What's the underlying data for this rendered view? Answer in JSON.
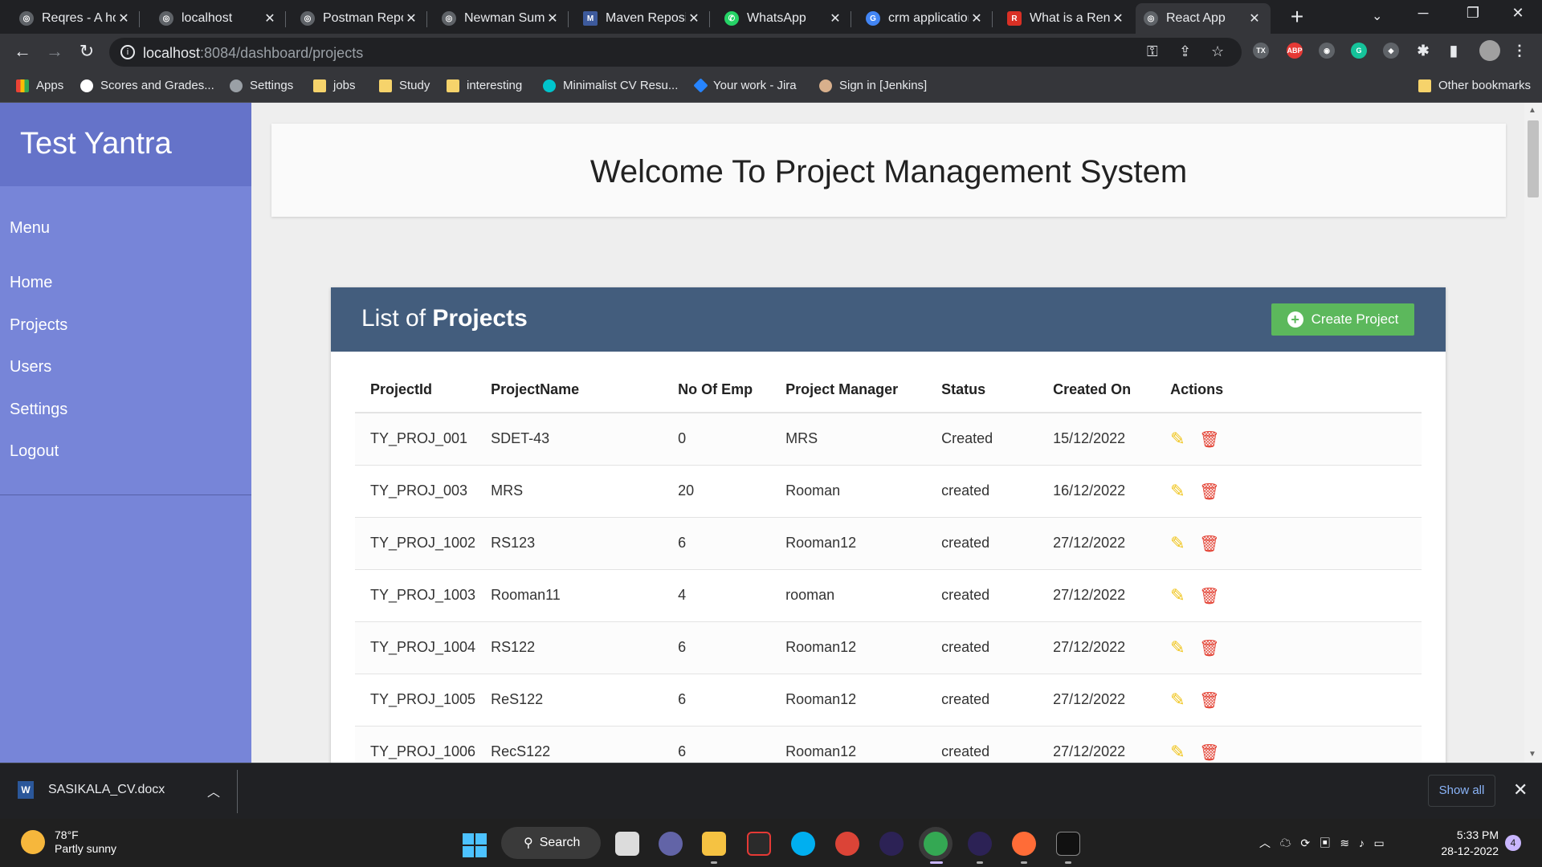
{
  "browser": {
    "tabs": [
      {
        "title": "Reqres - A hosted REST-API",
        "active": false
      },
      {
        "title": "localhost",
        "active": false
      },
      {
        "title": "Postman Report",
        "active": false
      },
      {
        "title": "Newman Summary Report",
        "active": false
      },
      {
        "title": "Maven Repository",
        "active": false
      },
      {
        "title": "WhatsApp",
        "active": false
      },
      {
        "title": "crm application",
        "active": false
      },
      {
        "title": "What is a Rental",
        "active": false
      },
      {
        "title": "React App",
        "active": true
      }
    ],
    "url_host": "localhost",
    "url_rest": ":8084/dashboard/projects",
    "bookmarks": [
      {
        "label": "Apps",
        "icon": "apps-grid-icon"
      },
      {
        "label": "Scores and Grades...",
        "icon": "google-icon"
      },
      {
        "label": "Settings",
        "icon": "gear-icon"
      },
      {
        "label": "jobs",
        "icon": "folder-icon"
      },
      {
        "label": "Study",
        "icon": "folder-icon"
      },
      {
        "label": "interesting",
        "icon": "folder-icon"
      },
      {
        "label": "Minimalist CV Resu...",
        "icon": "canva-icon"
      },
      {
        "label": "Your work - Jira",
        "icon": "jira-icon"
      },
      {
        "label": "Sign in [Jenkins]",
        "icon": "jenkins-icon"
      }
    ],
    "other_bookmarks": "Other bookmarks"
  },
  "app": {
    "brand": "Test Yantra",
    "menu_heading": "Menu",
    "nav": [
      "Home",
      "Projects",
      "Users",
      "Settings",
      "Logout"
    ],
    "welcome": "Welcome To Project Management System",
    "list_title_prefix": "List of",
    "list_title_bold": "Projects",
    "create_button": "Create Project",
    "columns": [
      "ProjectId",
      "ProjectName",
      "No Of Emp",
      "Project Manager",
      "Status",
      "Created On",
      "Actions"
    ],
    "rows": [
      [
        "TY_PROJ_001",
        "SDET-43",
        "0",
        "MRS",
        "Created",
        "15/12/2022"
      ],
      [
        "TY_PROJ_003",
        "MRS",
        "20",
        "Rooman",
        "created",
        "16/12/2022"
      ],
      [
        "TY_PROJ_1002",
        "RS123",
        "6",
        "Rooman12",
        "created",
        "27/12/2022"
      ],
      [
        "TY_PROJ_1003",
        "Rooman11",
        "4",
        "rooman",
        "created",
        "27/12/2022"
      ],
      [
        "TY_PROJ_1004",
        "RS122",
        "6",
        "Rooman12",
        "created",
        "27/12/2022"
      ],
      [
        "TY_PROJ_1005",
        "ReS122",
        "6",
        "Rooman12",
        "created",
        "27/12/2022"
      ],
      [
        "TY_PROJ_1006",
        "RecS122",
        "6",
        "Rooman12",
        "created",
        "27/12/2022"
      ]
    ]
  },
  "downloads": {
    "file": "SASIKALA_CV.docx",
    "show_all": "Show all"
  },
  "taskbar": {
    "weather_temp": "78°F",
    "weather_desc": "Partly sunny",
    "search": "Search",
    "time": "5:33 PM",
    "date": "28-12-2022",
    "notifications": "4"
  },
  "colors": {
    "sidebar": "#7785d8",
    "brand_bar": "#6573c9",
    "card_header": "#435d7d",
    "create_button": "#5cb85c",
    "edit_icon": "#f0c419",
    "delete_icon": "#e34234"
  }
}
